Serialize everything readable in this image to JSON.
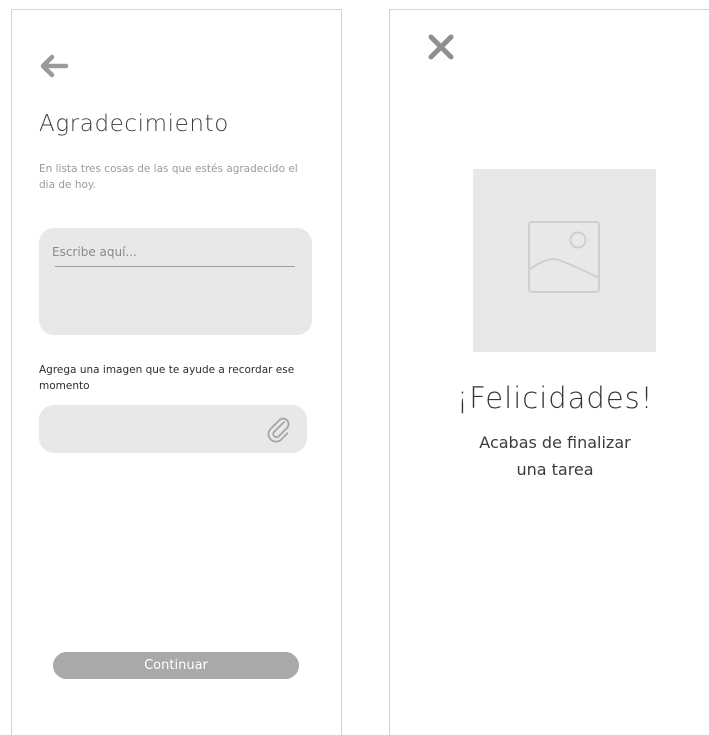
{
  "gratitude_screen": {
    "back_icon": "arrow-left-icon",
    "title": "Agradecimiento",
    "subtitle": "En lista tres cosas de las que estés agradecido el dia de hoy.",
    "text_input": {
      "placeholder": "Escribe aquí...",
      "value": ""
    },
    "image_prompt": "Agrega una imagen que te ayude a recordar ese momento",
    "attach_icon": "paperclip-icon",
    "continue_label": "Continuar"
  },
  "congrats_screen": {
    "close_icon": "close-icon",
    "image_icon": "image-placeholder-icon",
    "title": "¡Felicidades!",
    "message": "Acabas de finalizar una tarea"
  },
  "colors": {
    "field_bg": "#e8e8e8",
    "button_bg": "#a9a9a9",
    "icon": "#9a9a9a",
    "text": "#3a3a3a"
  }
}
